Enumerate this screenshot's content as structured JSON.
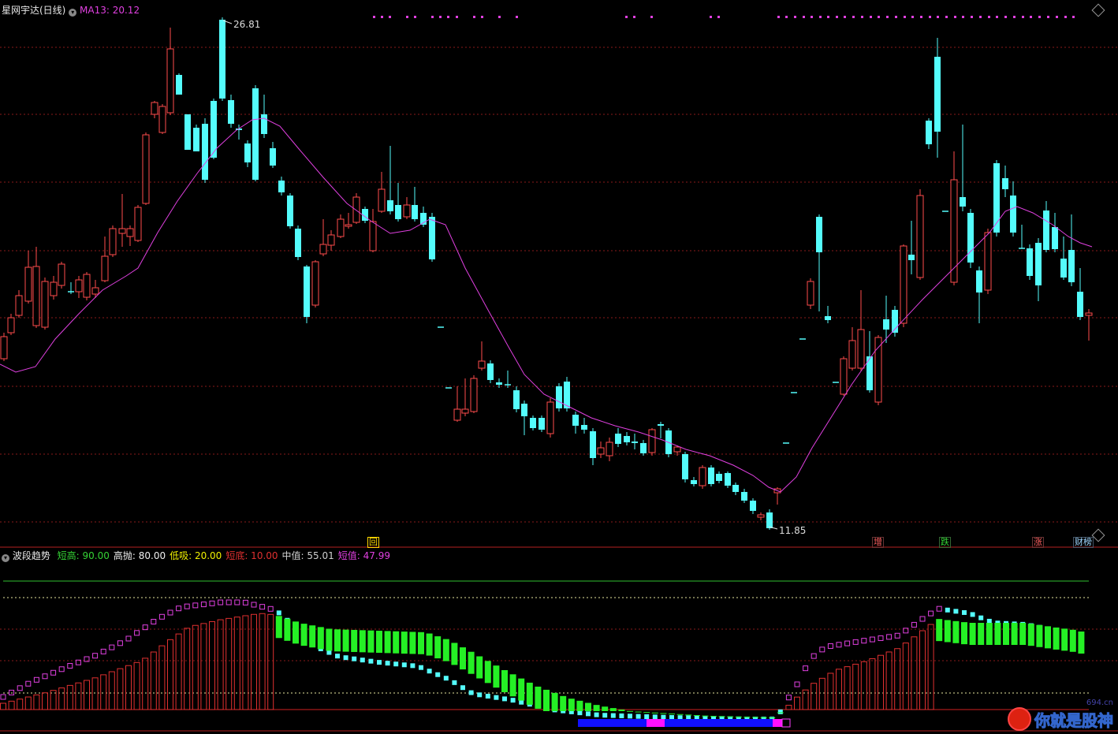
{
  "main_panel": {
    "title": "星网宇达(日线)",
    "ma_label": "MA13: 20.12",
    "high_label": "26.81",
    "low_label": "11.85",
    "event_markers": [
      "回",
      "增",
      "跌",
      "涨",
      "财榜"
    ]
  },
  "indicator_panel": {
    "name": "波段趋势",
    "params": [
      {
        "label": "短高:",
        "value": "90.00",
        "color": "#35d435"
      },
      {
        "label": "高抛:",
        "value": "80.00",
        "color": "#f0f0f0"
      },
      {
        "label": "低吸:",
        "value": "20.00",
        "color": "#f0f000"
      },
      {
        "label": "短底:",
        "value": "10.00",
        "color": "#e03030"
      },
      {
        "label": "中值:",
        "value": "55.01",
        "color": "#cfcfcf"
      },
      {
        "label": "短值:",
        "value": "47.99",
        "color": "#e040e0"
      }
    ]
  },
  "colors": {
    "up": "#ff4d4d",
    "down": "#54fcfc",
    "ma": "#e040e0",
    "grid": "#8a1a1a"
  },
  "watermark": {
    "site": "694.cn",
    "text": "你就是股神"
  },
  "icons": [
    "collapse-icon",
    "settings-icon",
    "diamond-icon"
  ]
}
